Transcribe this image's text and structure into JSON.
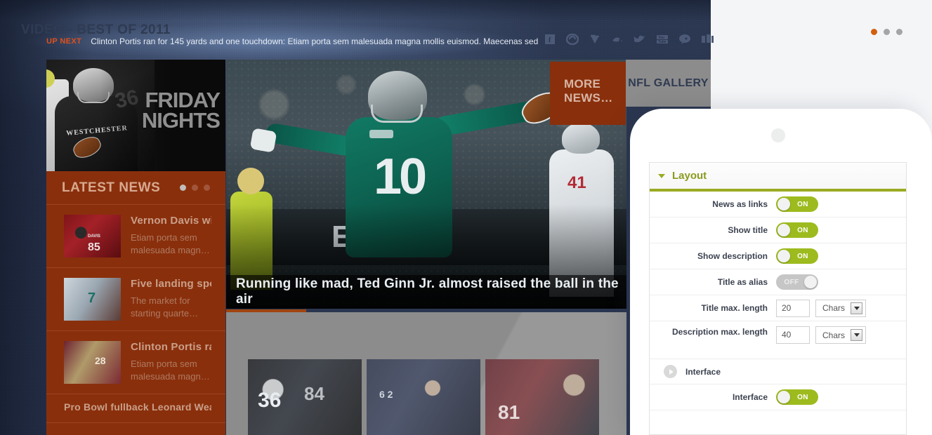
{
  "colors": {
    "site_bg": "#2b3650",
    "brand_orange": "#8a2f0c",
    "accent_orange": "#e0501c",
    "toggle_on": "#9dbb1e",
    "toggle_off": "#c6c6c6",
    "section_green": "#9aab22",
    "panel_bg": "#f4f5f7"
  },
  "ticker": {
    "label": "UP NEXT",
    "text": "Clinton Portis ran for 145 yards and one touchdown: Etiam porta sem malesuada magna mollis euismod. Maecenas sed"
  },
  "social": [
    {
      "name": "facebook-icon",
      "glyph": "f"
    },
    {
      "name": "stumbleupon-icon",
      "glyph": "su"
    },
    {
      "name": "vimeo-icon",
      "glyph": "V"
    },
    {
      "name": "dribbble-icon",
      "glyph": ""
    },
    {
      "name": "twitter-icon",
      "glyph": ""
    },
    {
      "name": "youtube-icon",
      "glyph": "You"
    },
    {
      "name": "comment-icon",
      "glyph": ""
    },
    {
      "name": "flickr-icon",
      "glyph": ""
    }
  ],
  "feature_banner": {
    "title_line1": "FRIDAY",
    "title_line2": "NIGHTS",
    "jersey_team": "WESTCHESTER",
    "jersey_number": "36"
  },
  "latest_news": {
    "heading": "LATEST NEWS",
    "dots": 3,
    "active_dot": 0,
    "items": [
      {
        "title": "Vernon Davis will…",
        "desc": "Etiam porta sem malesuada magn…"
      },
      {
        "title": "Five landing spot…",
        "desc": "The market for starting quarte…"
      },
      {
        "title": "Clinton Portis ra…",
        "desc": "Etiam porta sem malesuada magn…"
      },
      {
        "title": "Pro Bowl fullback Leonard Weav…",
        "desc": ""
      }
    ]
  },
  "hero": {
    "caption": "Running like mad, Ted Ginn Jr. almost raised the ball in the air",
    "banner_text": "EN WE",
    "jersey_number": "10",
    "opponent_number": "41",
    "progress_percent": 20
  },
  "tabs": {
    "more_news": "MORE NEWS…",
    "nfl_gallery": "NFL GALLERY"
  },
  "video_section": {
    "title": "VIDEO - BEST OF 2011",
    "dots": 3,
    "active_dot": 0,
    "thumbs": [
      {
        "label_a": "36",
        "label_b": "84"
      },
      {
        "label_a": "6 2",
        "label_b": ""
      },
      {
        "label_a": "81",
        "label_b": ""
      }
    ]
  },
  "settings": {
    "section_title": "Layout",
    "rows": [
      {
        "label": "News as links",
        "type": "toggle",
        "value": "ON"
      },
      {
        "label": "Show title",
        "type": "toggle",
        "value": "ON"
      },
      {
        "label": "Show description",
        "type": "toggle",
        "value": "ON"
      },
      {
        "label": "Title as alias",
        "type": "toggle",
        "value": "OFF"
      },
      {
        "label": "Title max. length",
        "type": "number",
        "value": "20",
        "unit": "Chars"
      },
      {
        "label": "Description max. length",
        "type": "number",
        "value": "40",
        "unit": "Chars"
      }
    ],
    "subsection": {
      "title": "Interface"
    },
    "sub_rows": [
      {
        "label": "Interface",
        "type": "toggle",
        "value": "ON"
      }
    ]
  }
}
